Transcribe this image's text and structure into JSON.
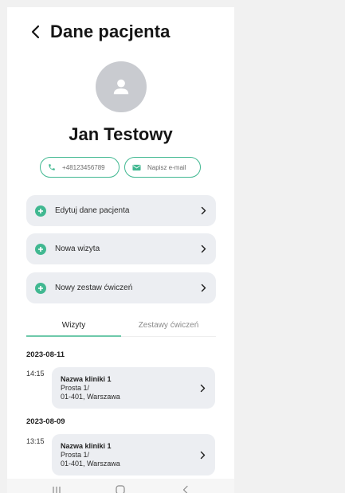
{
  "header": {
    "title": "Dane pacjenta"
  },
  "patient": {
    "name": "Jan Testowy",
    "phone": "+48123456789",
    "email_label": "Napisz e-mail"
  },
  "menu": [
    {
      "label": "Edytuj dane pacjenta",
      "icon": "plus-circle-icon"
    },
    {
      "label": "Nowa wizyta",
      "icon": "plus-circle-icon"
    },
    {
      "label": "Nowy zestaw ćwiczeń",
      "icon": "plus-circle-icon"
    }
  ],
  "tabs": [
    {
      "label": "Wizyty",
      "active": true
    },
    {
      "label": "Zestawy ćwiczeń",
      "active": false
    }
  ],
  "visits": [
    {
      "date": "2023-08-11",
      "time": "14:15",
      "clinic": "Nazwa kliniki 1",
      "street": "Prosta 1/",
      "city": "01-401, Warszawa"
    },
    {
      "date": "2023-08-09",
      "time": "13:15",
      "clinic": "Nazwa kliniki 1",
      "street": "Prosta 1/",
      "city": "01-401, Warszawa"
    }
  ],
  "colors": {
    "accent": "#41b891",
    "card_bg": "#eceef2",
    "avatar_bg": "#c9cbd0",
    "text_dark": "#151515"
  }
}
